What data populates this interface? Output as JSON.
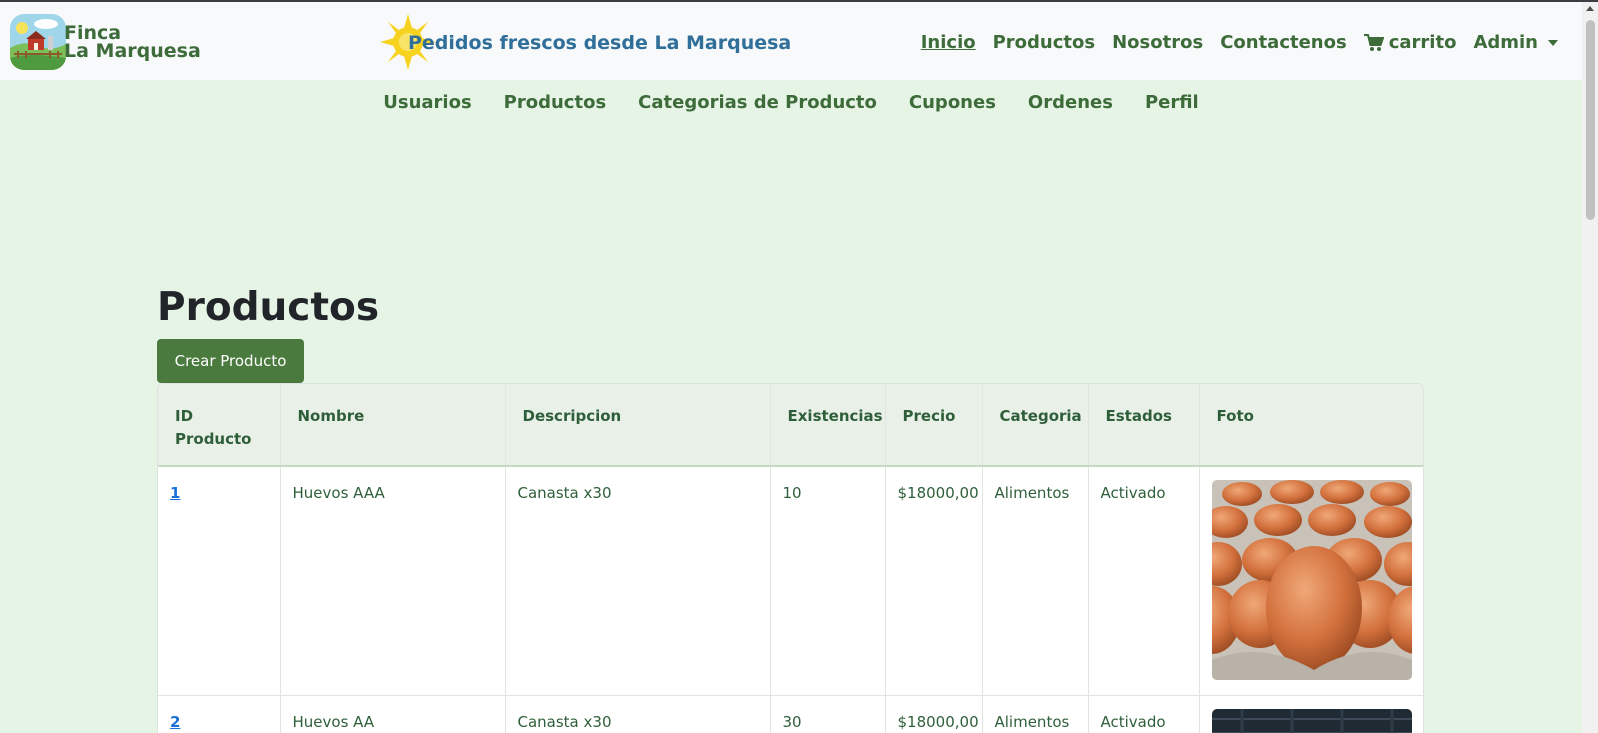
{
  "brand": {
    "line1": "Finca",
    "line2": "La Marquesa",
    "logo_icon": "farm-logo-icon"
  },
  "tagline": "Pedidos frescos desde La Marquesa",
  "nav": {
    "inicio": "Inicio",
    "productos": "Productos",
    "nosotros": "Nosotros",
    "contactenos": "Contactenos",
    "carrito": "carrito",
    "admin": "Admin"
  },
  "subnav": {
    "usuarios": "Usuarios",
    "productos": "Productos",
    "categorias": "Categorias de Producto",
    "cupones": "Cupones",
    "ordenes": "Ordenes",
    "perfil": "Perfil"
  },
  "page": {
    "title": "Productos",
    "create_button": "Crear Producto"
  },
  "table": {
    "headers": {
      "id_line1": "ID",
      "id_line2": "Producto",
      "nombre": "Nombre",
      "descripcion": "Descripcion",
      "existencias": "Existencias",
      "precio": "Precio",
      "categoria": "Categoria",
      "estados": "Estados",
      "foto": "Foto"
    },
    "rows": [
      {
        "id": "1",
        "nombre": "Huevos AAA",
        "descripcion": "Canasta x30",
        "existencias": "10",
        "precio": "$18000,00",
        "categoria": "Alimentos",
        "estado": "Activado"
      },
      {
        "id": "2",
        "nombre": "Huevos AA",
        "descripcion": "Canasta x30",
        "existencias": "30",
        "precio": "$18000,00",
        "categoria": "Alimentos",
        "estado": "Activado"
      }
    ]
  },
  "colors": {
    "page_bg": "#e6f4e6",
    "brand_green": "#3d6b3a",
    "tagline_blue": "#2f6f9a",
    "button_green": "#4a7a3e",
    "link_blue": "#1a6fd8"
  }
}
